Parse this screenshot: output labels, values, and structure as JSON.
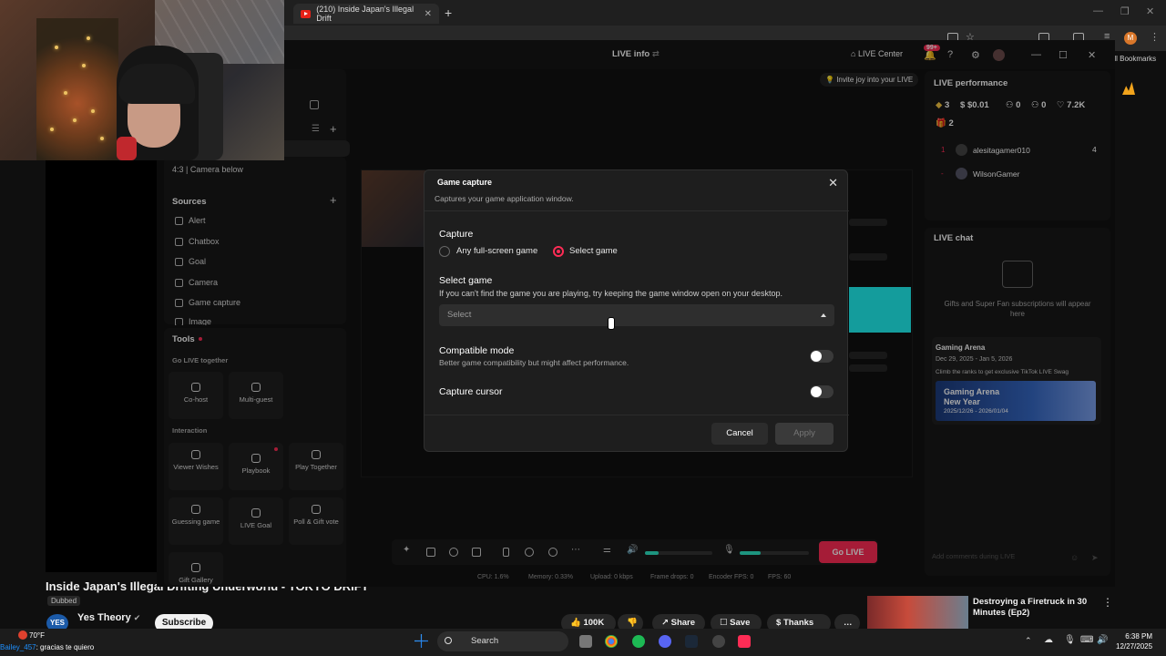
{
  "browser": {
    "tab_title": "(210) Inside Japan's Illegal Drift",
    "new_tab": "+",
    "bookmarks": "All Bookmarks",
    "profile_initial": "M"
  },
  "studio": {
    "header_title": "LIVE info",
    "live_center": "LIVE Center",
    "notifications": "99+",
    "invite": "Invite joy into your LIVE"
  },
  "left_panel": {
    "camera_layout": "4:3 | Camera below",
    "sources_title": "Sources",
    "sources": [
      "Alert",
      "Chatbox",
      "Goal",
      "Camera",
      "Game capture",
      "Image"
    ],
    "tools_title": "Tools",
    "go_live_together": "Go LIVE together",
    "together_tools": [
      "Co-host",
      "Multi-guest"
    ],
    "interaction": "Interaction",
    "interaction_tools": [
      "Viewer Wishes",
      "Playbook",
      "Play Together",
      "Guessing game",
      "LIVE Goal",
      "Poll & Gift vote",
      "Gift Gallery"
    ]
  },
  "performance": {
    "title": "LIVE performance",
    "stats": [
      "3",
      "$0.01",
      "0",
      "0",
      "7.2K",
      "2"
    ],
    "viewers": [
      {
        "rank": "1",
        "name": "alesitagamer010",
        "count": "4"
      },
      {
        "rank": "-",
        "name": "WilsonGamer",
        "count": ""
      }
    ]
  },
  "chat": {
    "title": "LIVE chat",
    "empty": "Gifts and Super Fan subscriptions will appear here",
    "event_title": "Gaming Arena",
    "event_dates": "Dec 29, 2025 - Jan 5, 2026",
    "event_desc": "Climb the ranks to get exclusive TikTok LIVE Swag",
    "banner_title": "Gaming Arena New Year",
    "banner_dates": "2025/12/26 - 2026/01/04",
    "input_placeholder": "Add comments during LIVE"
  },
  "toolbar": {
    "go_live": "Go LIVE",
    "stats": {
      "cpu": "CPU: 1.6%",
      "memory": "Memory: 0.33%",
      "upload": "Upload: 0 kbps",
      "frame_drops": "Frame drops: 0",
      "encoder": "Encoder FPS: 0",
      "fps": "FPS: 60"
    },
    "volume_level": 0.2,
    "mic_level": 0.3
  },
  "modal": {
    "title": "Game capture",
    "subtitle": "Captures your game application window.",
    "capture_label": "Capture",
    "option_any": "Any full-screen game",
    "option_select": "Select game",
    "select_game_label": "Select game",
    "select_game_hint": "If you can't find the game you are playing, try keeping the game window open on your desktop.",
    "select_placeholder": "Select",
    "compat_label": "Compatible mode",
    "compat_desc": "Better game compatibility but might affect performance.",
    "cursor_label": "Capture cursor",
    "cancel": "Cancel",
    "apply": "Apply"
  },
  "youtube": {
    "title": "Inside Japan's Illegal Drifting Underworld - TOKYO DRIFT",
    "dubbed": "Dubbed",
    "channel": "Yes Theory",
    "channel_avatar": "YES",
    "subscribe": "Subscribe",
    "likes": "100K",
    "share": "Share",
    "save": "Save",
    "thanks": "Thanks",
    "rec_title": "Destroying a Firetruck in 30 Minutes (Ep2)"
  },
  "taskbar": {
    "weather": "70°F",
    "search": "Search",
    "time": "6:38 PM",
    "date": "12/27/2025",
    "chat_user": "Bailey_457",
    "chat_message": ": gracias te quiero"
  },
  "colors": {
    "accent": "#fe2c55",
    "teal": "#2de3c4"
  }
}
